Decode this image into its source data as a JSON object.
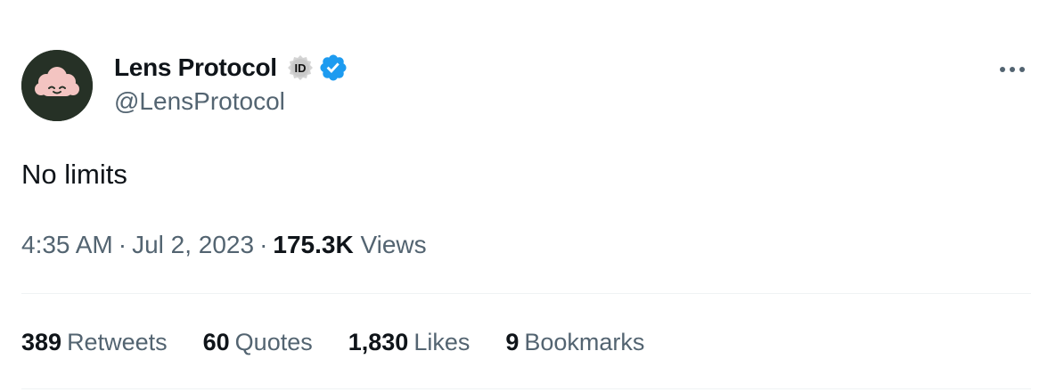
{
  "author": {
    "display_name": "Lens Protocol",
    "handle": "@LensProtocol",
    "avatar_icon": "lens-cloud-face-icon",
    "avatar_bg": "#263126",
    "id_badge_label": "ID",
    "verified_color": "#1d9bf0"
  },
  "tweet": {
    "text": "No limits"
  },
  "meta": {
    "time": "4:35 AM",
    "separator": "·",
    "date": "Jul 2, 2023",
    "views_count": "175.3K",
    "views_label": "Views"
  },
  "stats": [
    {
      "count": "389",
      "label": "Retweets"
    },
    {
      "count": "60",
      "label": "Quotes"
    },
    {
      "count": "1,830",
      "label": "Likes"
    },
    {
      "count": "9",
      "label": "Bookmarks"
    }
  ],
  "colors": {
    "text_primary": "#0f1419",
    "text_secondary": "#536471",
    "divider": "#eff3f4"
  }
}
